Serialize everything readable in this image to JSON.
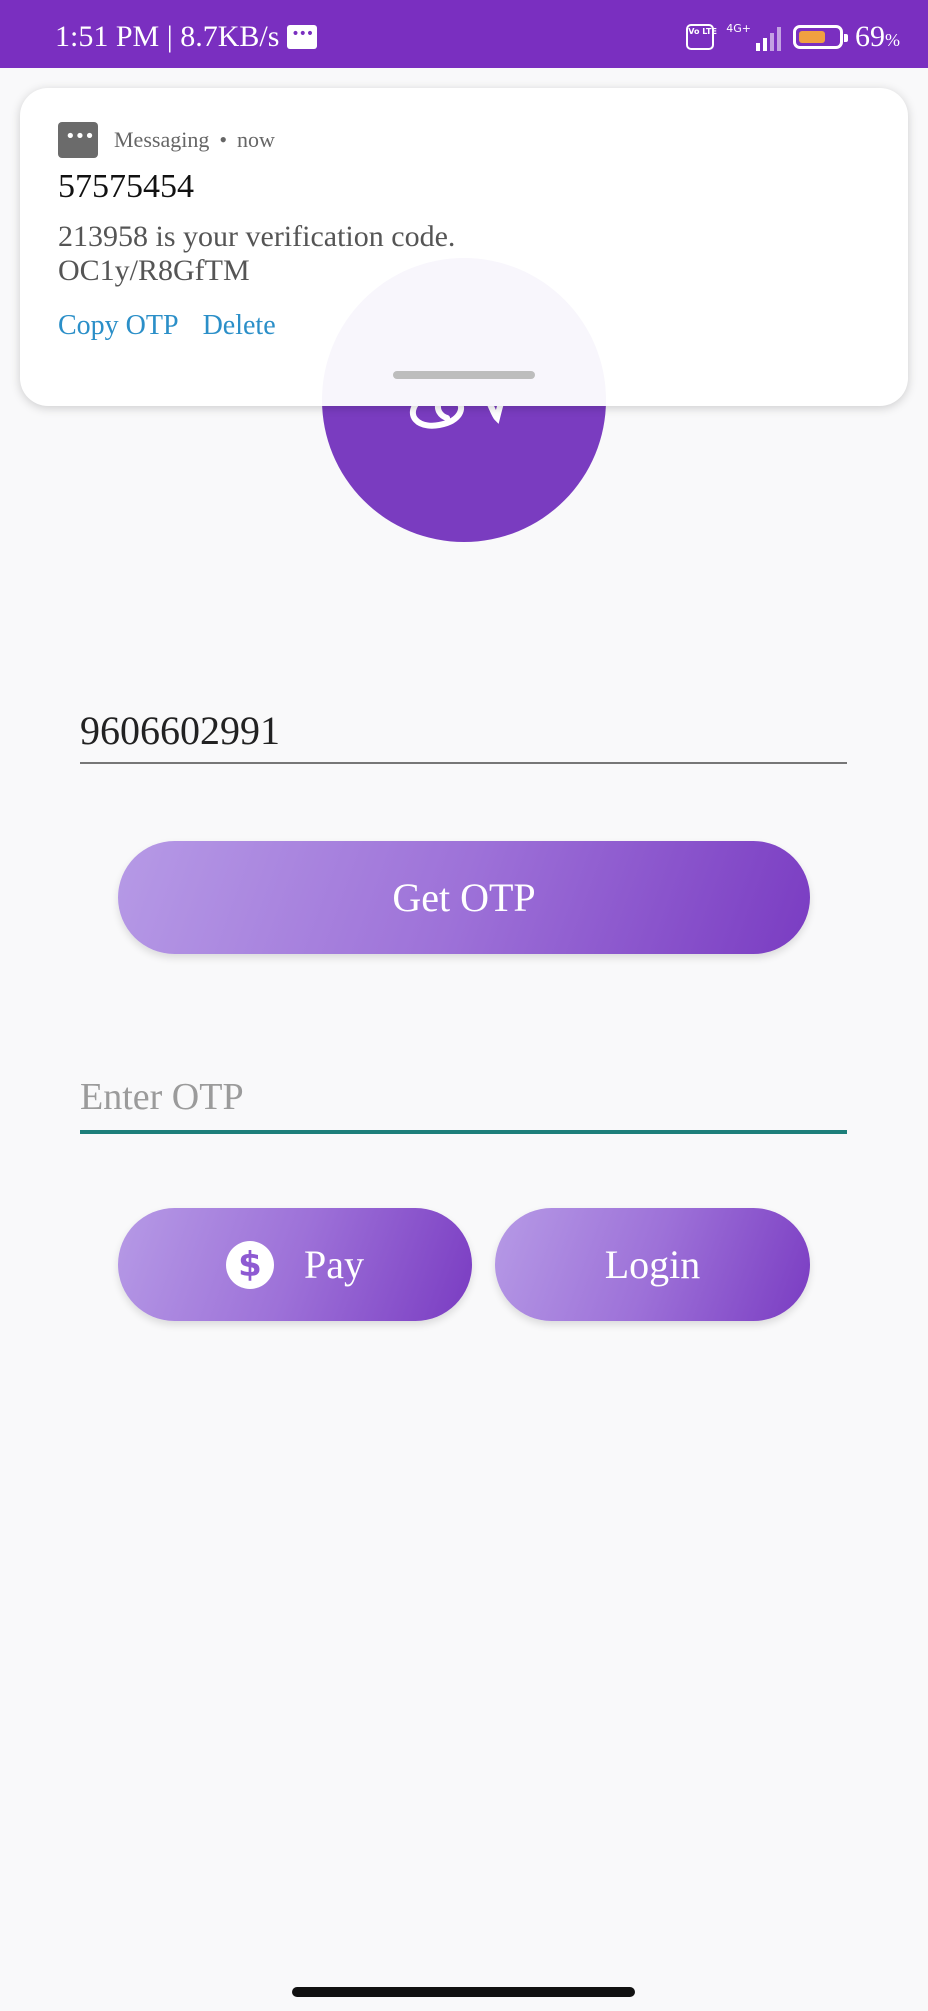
{
  "status_bar": {
    "time_speed": "1:51 PM | 8.7KB/s",
    "volte_label": "Vo LTE",
    "network_label": "4G+",
    "battery_percent": "69",
    "battery_unit": "%",
    "battery_level": 0.69,
    "background_color": "#7a2fc0"
  },
  "notification": {
    "app_name": "Messaging",
    "separator": "•",
    "time": "now",
    "title": "57575454",
    "body_line1": "213958 is your verification code.",
    "body_line2": "OC1y/R8GfTM",
    "actions": {
      "copy_otp": "Copy OTP",
      "delete": "Delete"
    },
    "app_icon": "message-bubble-icon"
  },
  "login_form": {
    "phone_value": "9606602991",
    "get_otp_label": "Get OTP",
    "otp_placeholder": "Enter OTP",
    "pay_label": "Pay",
    "login_label": "Login",
    "pay_icon": "dollar-circle-icon",
    "accent_color": "#7a3cc2",
    "focus_underline_color": "#1d7f7a"
  }
}
